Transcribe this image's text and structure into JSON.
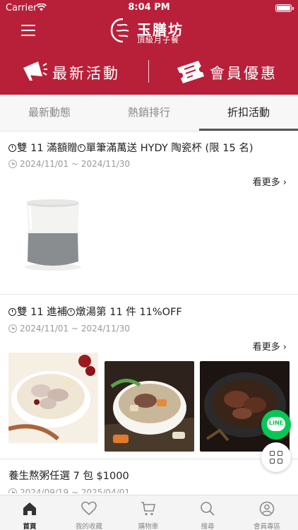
{
  "status_bar": {
    "carrier": "Carrier",
    "time": "8:04 PM"
  },
  "header": {
    "logo_name": "玉膳坊",
    "logo_subtitle": "頂級月子餐",
    "logo_mark_text": "玉膳坊",
    "promo_left_label": "最新活動",
    "promo_right_label": "會員優惠",
    "background_color": "#b8203a"
  },
  "tabs": [
    {
      "label": "最新動態",
      "active": false
    },
    {
      "label": "熱銷排行",
      "active": false
    },
    {
      "label": "折扣活動",
      "active": true
    }
  ],
  "posts": [
    {
      "title": "雙 11 滿額贈",
      "title_part2": "單筆滿萬送 HYDY 陶瓷杯 (限 15 名)",
      "date": "2024/11/01 ~ 2024/11/30",
      "more_label": "看更多 ›"
    },
    {
      "title": "雙 11 進補",
      "title_part2": "燉湯第 11 件 11%OFF",
      "date": "2024/11/01 ~ 2024/11/30",
      "more_label": "看更多 ›"
    },
    {
      "title": "養生熬粥任選 7 包 $1000",
      "date": "2024/09/19 ~ 2025/04/01"
    }
  ],
  "floating": {
    "line_label": "LINE"
  },
  "bottom_nav": [
    {
      "label": "首頁",
      "icon": "home-icon",
      "active": true
    },
    {
      "label": "我的收藏",
      "icon": "heart-icon",
      "active": false
    },
    {
      "label": "購物車",
      "icon": "cart-icon",
      "active": false
    },
    {
      "label": "搜尋",
      "icon": "search-icon",
      "active": false
    },
    {
      "label": "會員專區",
      "icon": "user-icon",
      "active": false
    }
  ]
}
